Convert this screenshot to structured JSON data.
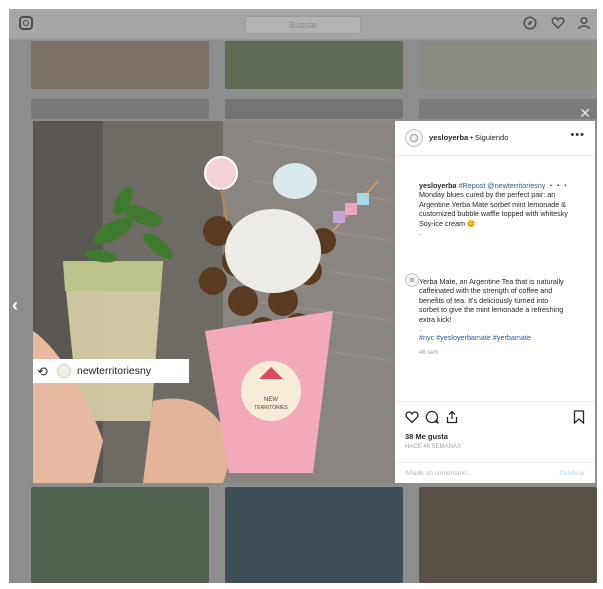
{
  "topbar": {
    "logo_icon": "instagram-icon",
    "search_placeholder": "Buscar",
    "icons": [
      "compass-icon",
      "heart-icon",
      "profile-icon"
    ]
  },
  "post": {
    "username": "yesloyerba",
    "following": "• Siguiendo",
    "caption_user": "yesloyerba",
    "caption_repost_tag": "#Repost",
    "caption_mention": "@newterritoriesny",
    "caption_rest": "・・・ Monday blues cured by the perfect pair: an Argentine Yerba Mate sorbet mint lemonade & customized bubble waffle topped with whitesky Soy-ice cream 😊",
    "caption_dot": ".",
    "comment_text": "Yerba Mate, an Argentine Tea that is naturally caffeinated with the strength of coffee and benefits of tea. It's deliciously turned into sorbet to give the mint lemonade a refreshing extra kick!",
    "comment_dot": ".",
    "comment_tags": "#nyc #yesloyerbamate #yerbamate",
    "comment_time": "46 sem",
    "likes": "38 Me gusta",
    "posted": "HACE 46 SEMANAS",
    "add_comment": "Añade un comentario...",
    "publish": "Publicar",
    "more_label": "•••"
  },
  "repost": {
    "icon": "repost-icon",
    "account": "newterritoriesny"
  },
  "photo": {
    "cup_label_line1": "NEW",
    "cup_label_line2": "TERRITORIES"
  },
  "nav": {
    "prev_label": "‹",
    "close_label": "✕"
  }
}
